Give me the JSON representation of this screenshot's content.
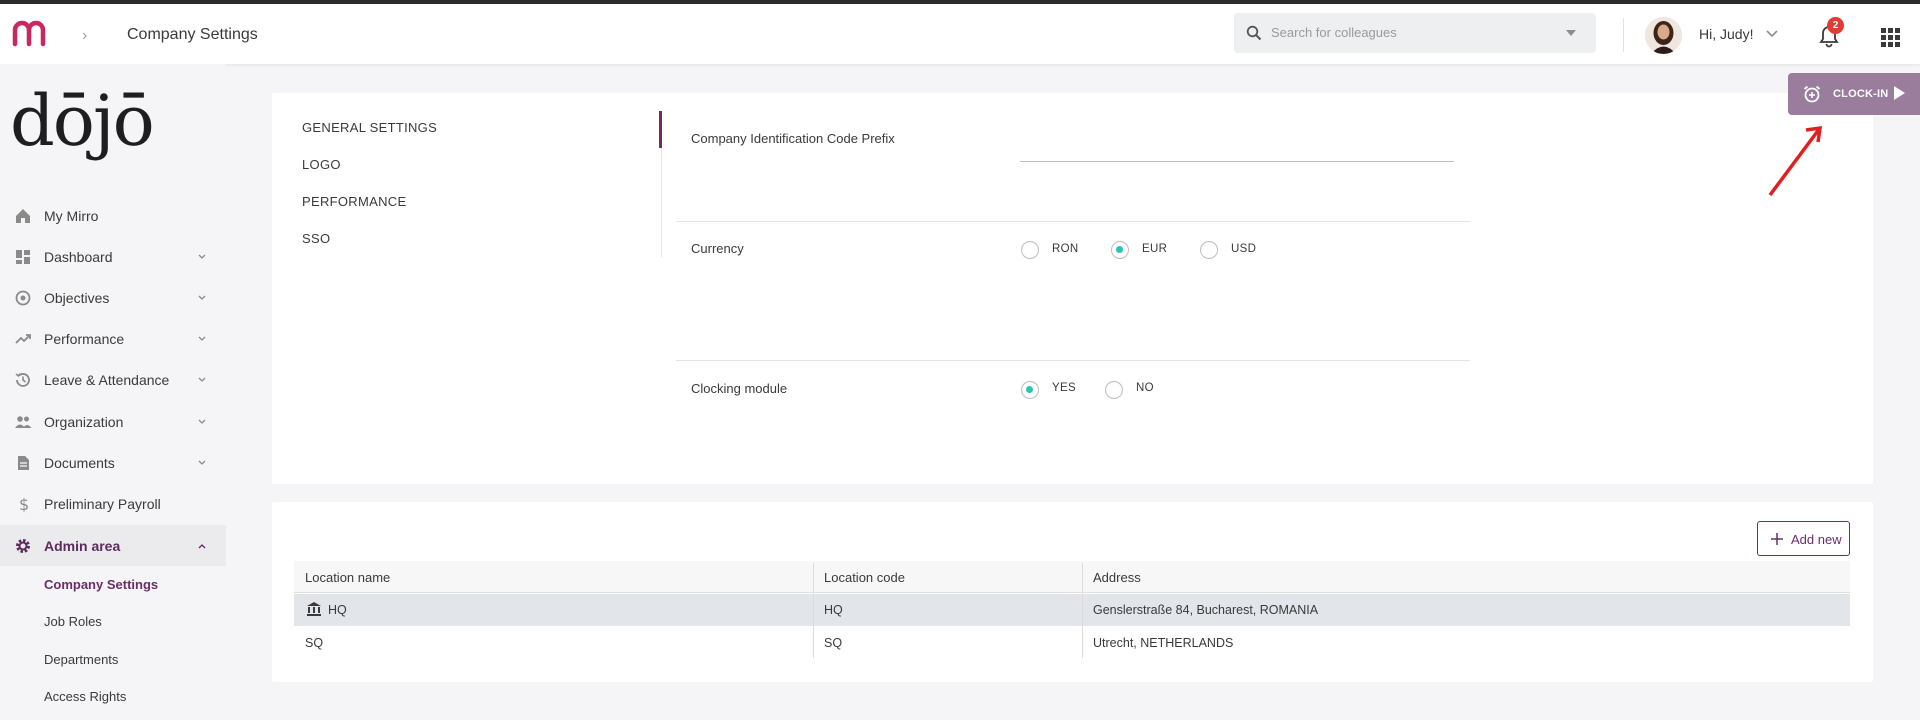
{
  "header": {
    "title": "Company Settings",
    "search_placeholder": "Search for colleagues",
    "greeting": "Hi, Judy!",
    "notifications_count": "2"
  },
  "clockin": {
    "label": "CLOCK-IN"
  },
  "sidebar": {
    "logo_text": "dōjō",
    "items": [
      {
        "label": "My Mirro",
        "icon": "home-icon",
        "expandable": false
      },
      {
        "label": "Dashboard",
        "icon": "dashboard-icon",
        "expandable": true
      },
      {
        "label": "Objectives",
        "icon": "target-icon",
        "expandable": true
      },
      {
        "label": "Performance",
        "icon": "trending-up-icon",
        "expandable": true
      },
      {
        "label": "Leave & Attendance",
        "icon": "history-icon",
        "expandable": true
      },
      {
        "label": "Organization",
        "icon": "people-icon",
        "expandable": true
      },
      {
        "label": "Documents",
        "icon": "document-icon",
        "expandable": true
      },
      {
        "label": "Preliminary Payroll",
        "icon": "dollar-icon",
        "expandable": false
      },
      {
        "label": "Admin area",
        "icon": "gear-icon",
        "expandable": true,
        "active": true
      }
    ],
    "subitems": [
      "Company Settings",
      "Job Roles",
      "Departments",
      "Access Rights"
    ]
  },
  "settings": {
    "tabs": [
      "GENERAL SETTINGS",
      "LOGO",
      "PERFORMANCE",
      "SSO"
    ],
    "company_code_label": "Company Identification Code Prefix",
    "company_code_value": "",
    "currency_label": "Currency",
    "currency_options": [
      "RON",
      "EUR",
      "USD"
    ],
    "currency_selected": "EUR",
    "clocking_label": "Clocking module",
    "clocking_options": [
      "YES",
      "NO"
    ],
    "clocking_selected": "YES"
  },
  "locations": {
    "add_label": "Add new",
    "columns": [
      "Location name",
      "Location code",
      "Address"
    ],
    "rows": [
      {
        "name": "HQ",
        "code": "HQ",
        "address": "Genslerstraße 84, Bucharest, ROMANIA"
      },
      {
        "name": "SQ",
        "code": "SQ",
        "address": "Utrecht, NETHERLANDS"
      }
    ]
  },
  "colors": {
    "brand": "#6b2d6b",
    "accent_radio": "#26c6b3",
    "clockin_bg": "#9a7c9d",
    "badge": "#e53935"
  }
}
